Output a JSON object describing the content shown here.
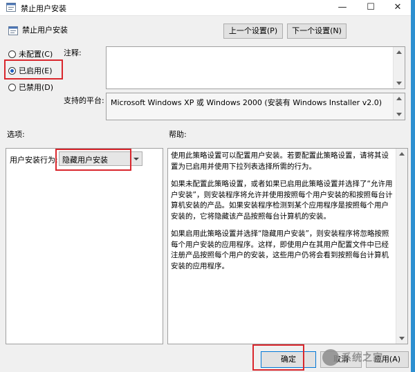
{
  "window": {
    "title": "禁止用户安装",
    "controls": {
      "minimize": "—",
      "maximize": "☐",
      "close": "✕"
    }
  },
  "header": {
    "title": "禁止用户安装",
    "prev_button": "上一个设置(P)",
    "next_button": "下一个设置(N)"
  },
  "state": {
    "options": [
      {
        "label": "未配置(C)",
        "selected": false
      },
      {
        "label": "已启用(E)",
        "selected": true
      },
      {
        "label": "已禁用(D)",
        "selected": false
      }
    ]
  },
  "comment": {
    "label": "注释:",
    "value": ""
  },
  "supported": {
    "label": "支持的平台:",
    "value": "Microsoft Windows XP 或 Windows 2000 (安装有 Windows Installer v2.0)"
  },
  "options_section": {
    "label": "选项:",
    "behavior_label": "用户安装行为:",
    "behavior_value": "隐藏用户安装"
  },
  "help_section": {
    "label": "帮助:",
    "paragraphs": [
      "使用此策略设置可以配置用户安装。若要配置此策略设置，请将其设置为已启用并使用下拉列表选择所需的行为。",
      "如果未配置此策略设置，或者如果已启用此策略设置并选择了“允许用户安装”，则安装程序将允许并使用按照每个用户安装的和按照每台计算机安装的产品。如果安装程序检测到某个应用程序是按照每个用户安装的，它将隐藏该产品按照每台计算机的安装。",
      "如果启用此策略设置并选择“隐藏用户安装”，则安装程序将忽略按照每个用户安装的应用程序。这样，即使用户在其用户配置文件中已经注册产品按照每个用户的安装，这些用户仍将会看到按照每台计算机安装的应用程序。"
    ]
  },
  "footer": {
    "ok_button": "确定",
    "cancel_button": "取消",
    "apply_button": "应用(A)"
  },
  "watermark": {
    "text": "系统之家"
  },
  "colors": {
    "highlight_box": "#d9262c",
    "radio_dot": "#1c5fc2",
    "accent_strip": "#2d8fd0"
  }
}
